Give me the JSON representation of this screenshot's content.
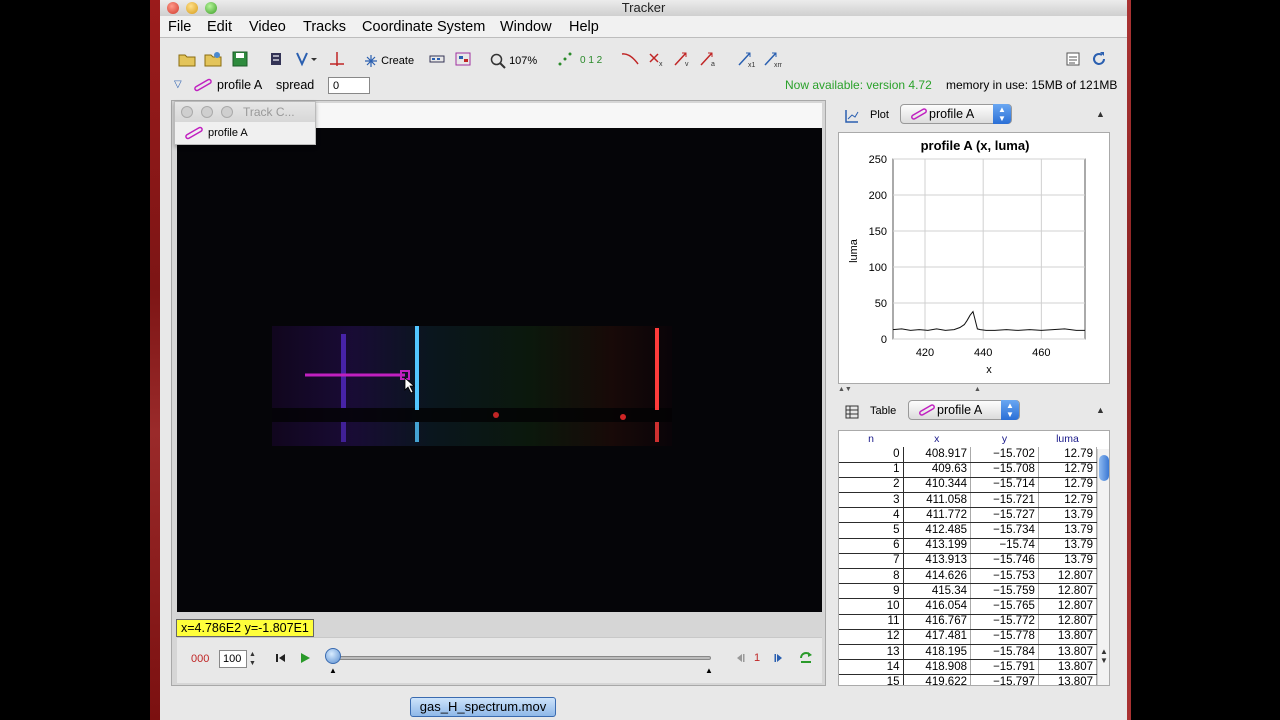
{
  "window": {
    "title": "Tracker"
  },
  "menu": [
    "File",
    "Edit",
    "Video",
    "Tracks",
    "Coordinate System",
    "Window",
    "Help"
  ],
  "toolbar": {
    "create_label": "Create",
    "zoom_label": "107%",
    "steps_label": "0 1 2"
  },
  "trackbar": {
    "track_name": "profile A",
    "spread_label": "spread",
    "spread_value": "0",
    "notice": "Now available: version 4.72",
    "memory": "memory in use: 15MB of 121MB"
  },
  "track_control": {
    "title": "Track C...",
    "item": "profile A"
  },
  "video": {
    "coordinate_readout": "x=4.786E2  y=-1.807E1"
  },
  "player": {
    "step_count": "000",
    "step_size": "100",
    "frame_number": "1"
  },
  "plot": {
    "tab_label": "Plot",
    "dropdown": "profile A",
    "chart_data": {
      "type": "line",
      "title": "profile A (x, luma)",
      "xlabel": "x",
      "ylabel": "luma",
      "xlim": [
        409,
        475
      ],
      "ylim": [
        0,
        250
      ],
      "x_ticks": [
        420,
        440,
        460
      ],
      "y_ticks": [
        0,
        50,
        100,
        150,
        200,
        250
      ],
      "grid": true,
      "series": [
        {
          "x": [
            409,
            412,
            415,
            418,
            421,
            424,
            427,
            430,
            432,
            433.5,
            434.5,
            435.5,
            436.5,
            437,
            438,
            439,
            441,
            444,
            448,
            452,
            456,
            460,
            464,
            468,
            472,
            475
          ],
          "y": [
            13,
            14,
            12,
            13,
            12,
            14,
            12,
            13,
            16,
            20,
            26,
            33,
            38,
            30,
            14,
            13,
            12,
            12,
            13,
            12,
            13,
            12,
            13,
            14,
            12,
            12
          ]
        }
      ]
    }
  },
  "table": {
    "tab_label": "Table",
    "dropdown": "profile A",
    "columns": [
      "n",
      "x",
      "y",
      "luma"
    ],
    "rows": [
      [
        "0",
        "408.917",
        "−15.702",
        "12.79"
      ],
      [
        "1",
        "409.63",
        "−15.708",
        "12.79"
      ],
      [
        "2",
        "410.344",
        "−15.714",
        "12.79"
      ],
      [
        "3",
        "411.058",
        "−15.721",
        "12.79"
      ],
      [
        "4",
        "411.772",
        "−15.727",
        "13.79"
      ],
      [
        "5",
        "412.485",
        "−15.734",
        "13.79"
      ],
      [
        "6",
        "413.199",
        "−15.74",
        "13.79"
      ],
      [
        "7",
        "413.913",
        "−15.746",
        "13.79"
      ],
      [
        "8",
        "414.626",
        "−15.753",
        "12.807"
      ],
      [
        "9",
        "415.34",
        "−15.759",
        "12.807"
      ],
      [
        "10",
        "416.054",
        "−15.765",
        "12.807"
      ],
      [
        "11",
        "416.767",
        "−15.772",
        "12.807"
      ],
      [
        "12",
        "417.481",
        "−15.778",
        "13.807"
      ],
      [
        "13",
        "418.195",
        "−15.784",
        "13.807"
      ],
      [
        "14",
        "418.908",
        "−15.791",
        "13.807"
      ],
      [
        "15",
        "419.622",
        "−15.797",
        "13.807"
      ]
    ]
  },
  "status_file": "gas_H_spectrum.mov",
  "colors": {
    "track": "#c020c0",
    "notice": "#2aa12a",
    "readout_bg": "#ffff3b"
  }
}
